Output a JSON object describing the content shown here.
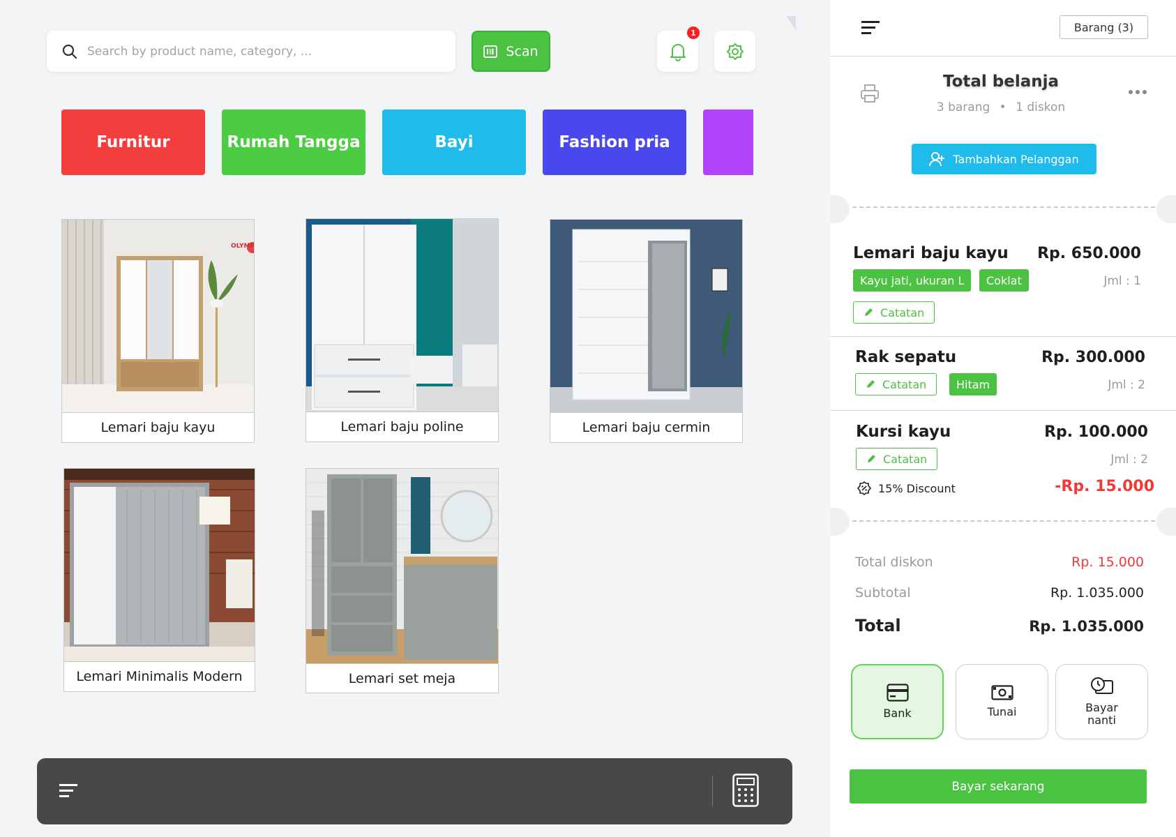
{
  "search": {
    "placeholder": "Search by product name, category, ..."
  },
  "scan": {
    "label": "Scan"
  },
  "notifications": {
    "count": "1"
  },
  "categories": [
    {
      "label": "Furnitur",
      "color": "#f43d3d"
    },
    {
      "label": "Rumah Tangga",
      "color": "#4ccc42"
    },
    {
      "label": "Bayi",
      "color": "#1ebbeb"
    },
    {
      "label": "Fashion pria",
      "color": "#4948ed"
    },
    {
      "label": "",
      "color": "#b143fb"
    }
  ],
  "products": [
    {
      "name": "Lemari baju kayu",
      "brand": "OLYMPIC"
    },
    {
      "name": "Lemari baju poline"
    },
    {
      "name": "Lemari baju cermin"
    },
    {
      "name": "Lemari Minimalis Modern"
    },
    {
      "name": "Lemari set meja"
    }
  ],
  "cart": {
    "items_button": "Barang (3)",
    "title": "Total belanja",
    "count_label": "3 barang",
    "discount_label": "1 diskon",
    "add_customer": "Tambahkan Pelanggan",
    "items": [
      {
        "name": "Lemari baju kayu",
        "price": "Rp. 650.000",
        "variant": "Kayu jati, ukuran L",
        "color": "Coklat",
        "qty": "Jml : 1",
        "note": "Catatan"
      },
      {
        "name": "Rak sepatu",
        "price": "Rp. 300.000",
        "color": "Hitam",
        "qty": "Jml : 2",
        "note": "Catatan"
      },
      {
        "name": "Kursi kayu",
        "price": "Rp. 100.000",
        "qty": "Jml : 2",
        "note": "Catatan",
        "discount_label": "15% Discount",
        "discount_value": "-Rp. 15.000"
      }
    ],
    "summary": {
      "total_discount_label": "Total diskon",
      "total_discount_value": "Rp. 15.000",
      "subtotal_label": "Subtotal",
      "subtotal_value": "Rp. 1.035.000",
      "total_label": "Total",
      "total_value": "Rp. 1.035.000"
    },
    "payment_methods": [
      {
        "label": "Bank",
        "icon": "card-icon",
        "active": true
      },
      {
        "label": "Tunai",
        "icon": "cash-icon",
        "active": false
      },
      {
        "label": "Bayar nanti",
        "icon": "clock-card-icon",
        "active": false
      }
    ],
    "pay_now": "Bayar sekarang"
  },
  "colors": {
    "green": "#4cc242",
    "red": "#f03a3a",
    "blue": "#1ebbeb",
    "dark_bar": "#484848"
  }
}
